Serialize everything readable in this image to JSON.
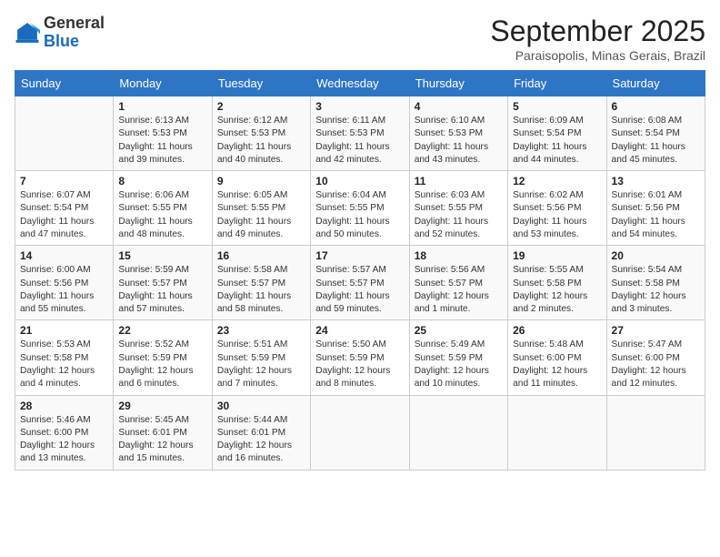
{
  "header": {
    "logo_line1": "General",
    "logo_line2": "Blue",
    "month": "September 2025",
    "location": "Paraisopolis, Minas Gerais, Brazil"
  },
  "days_of_week": [
    "Sunday",
    "Monday",
    "Tuesday",
    "Wednesday",
    "Thursday",
    "Friday",
    "Saturday"
  ],
  "weeks": [
    [
      {
        "num": "",
        "detail": ""
      },
      {
        "num": "1",
        "detail": "Sunrise: 6:13 AM\nSunset: 5:53 PM\nDaylight: 11 hours\nand 39 minutes."
      },
      {
        "num": "2",
        "detail": "Sunrise: 6:12 AM\nSunset: 5:53 PM\nDaylight: 11 hours\nand 40 minutes."
      },
      {
        "num": "3",
        "detail": "Sunrise: 6:11 AM\nSunset: 5:53 PM\nDaylight: 11 hours\nand 42 minutes."
      },
      {
        "num": "4",
        "detail": "Sunrise: 6:10 AM\nSunset: 5:53 PM\nDaylight: 11 hours\nand 43 minutes."
      },
      {
        "num": "5",
        "detail": "Sunrise: 6:09 AM\nSunset: 5:54 PM\nDaylight: 11 hours\nand 44 minutes."
      },
      {
        "num": "6",
        "detail": "Sunrise: 6:08 AM\nSunset: 5:54 PM\nDaylight: 11 hours\nand 45 minutes."
      }
    ],
    [
      {
        "num": "7",
        "detail": "Sunrise: 6:07 AM\nSunset: 5:54 PM\nDaylight: 11 hours\nand 47 minutes."
      },
      {
        "num": "8",
        "detail": "Sunrise: 6:06 AM\nSunset: 5:55 PM\nDaylight: 11 hours\nand 48 minutes."
      },
      {
        "num": "9",
        "detail": "Sunrise: 6:05 AM\nSunset: 5:55 PM\nDaylight: 11 hours\nand 49 minutes."
      },
      {
        "num": "10",
        "detail": "Sunrise: 6:04 AM\nSunset: 5:55 PM\nDaylight: 11 hours\nand 50 minutes."
      },
      {
        "num": "11",
        "detail": "Sunrise: 6:03 AM\nSunset: 5:55 PM\nDaylight: 11 hours\nand 52 minutes."
      },
      {
        "num": "12",
        "detail": "Sunrise: 6:02 AM\nSunset: 5:56 PM\nDaylight: 11 hours\nand 53 minutes."
      },
      {
        "num": "13",
        "detail": "Sunrise: 6:01 AM\nSunset: 5:56 PM\nDaylight: 11 hours\nand 54 minutes."
      }
    ],
    [
      {
        "num": "14",
        "detail": "Sunrise: 6:00 AM\nSunset: 5:56 PM\nDaylight: 11 hours\nand 55 minutes."
      },
      {
        "num": "15",
        "detail": "Sunrise: 5:59 AM\nSunset: 5:57 PM\nDaylight: 11 hours\nand 57 minutes."
      },
      {
        "num": "16",
        "detail": "Sunrise: 5:58 AM\nSunset: 5:57 PM\nDaylight: 11 hours\nand 58 minutes."
      },
      {
        "num": "17",
        "detail": "Sunrise: 5:57 AM\nSunset: 5:57 PM\nDaylight: 11 hours\nand 59 minutes."
      },
      {
        "num": "18",
        "detail": "Sunrise: 5:56 AM\nSunset: 5:57 PM\nDaylight: 12 hours\nand 1 minute."
      },
      {
        "num": "19",
        "detail": "Sunrise: 5:55 AM\nSunset: 5:58 PM\nDaylight: 12 hours\nand 2 minutes."
      },
      {
        "num": "20",
        "detail": "Sunrise: 5:54 AM\nSunset: 5:58 PM\nDaylight: 12 hours\nand 3 minutes."
      }
    ],
    [
      {
        "num": "21",
        "detail": "Sunrise: 5:53 AM\nSunset: 5:58 PM\nDaylight: 12 hours\nand 4 minutes."
      },
      {
        "num": "22",
        "detail": "Sunrise: 5:52 AM\nSunset: 5:59 PM\nDaylight: 12 hours\nand 6 minutes."
      },
      {
        "num": "23",
        "detail": "Sunrise: 5:51 AM\nSunset: 5:59 PM\nDaylight: 12 hours\nand 7 minutes."
      },
      {
        "num": "24",
        "detail": "Sunrise: 5:50 AM\nSunset: 5:59 PM\nDaylight: 12 hours\nand 8 minutes."
      },
      {
        "num": "25",
        "detail": "Sunrise: 5:49 AM\nSunset: 5:59 PM\nDaylight: 12 hours\nand 10 minutes."
      },
      {
        "num": "26",
        "detail": "Sunrise: 5:48 AM\nSunset: 6:00 PM\nDaylight: 12 hours\nand 11 minutes."
      },
      {
        "num": "27",
        "detail": "Sunrise: 5:47 AM\nSunset: 6:00 PM\nDaylight: 12 hours\nand 12 minutes."
      }
    ],
    [
      {
        "num": "28",
        "detail": "Sunrise: 5:46 AM\nSunset: 6:00 PM\nDaylight: 12 hours\nand 13 minutes."
      },
      {
        "num": "29",
        "detail": "Sunrise: 5:45 AM\nSunset: 6:01 PM\nDaylight: 12 hours\nand 15 minutes."
      },
      {
        "num": "30",
        "detail": "Sunrise: 5:44 AM\nSunset: 6:01 PM\nDaylight: 12 hours\nand 16 minutes."
      },
      {
        "num": "",
        "detail": ""
      },
      {
        "num": "",
        "detail": ""
      },
      {
        "num": "",
        "detail": ""
      },
      {
        "num": "",
        "detail": ""
      }
    ]
  ]
}
